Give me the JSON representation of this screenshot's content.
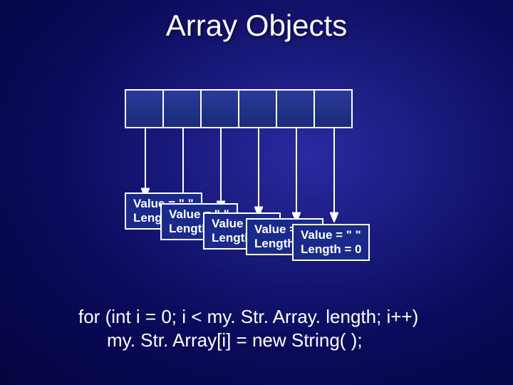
{
  "title": "Array Objects",
  "array": {
    "cell_count": 6
  },
  "cards": [
    {
      "value_line": "Value = \" \"",
      "length_line": "Length = 0"
    },
    {
      "value_line": "Value = \" \"",
      "length_line": "Length = 0"
    },
    {
      "value_line": "Value = \" \"",
      "length_line": "Length = 0"
    },
    {
      "value_line": "Value = \" \"",
      "length_line": "Length = 0"
    },
    {
      "value_line": "Value = \" \"",
      "length_line": "Length = 0"
    }
  ],
  "code": {
    "line1": "for (int i = 0; i < my. Str. Array. length; i++)",
    "line2": "my. Str. Array[i] = new String( );"
  }
}
